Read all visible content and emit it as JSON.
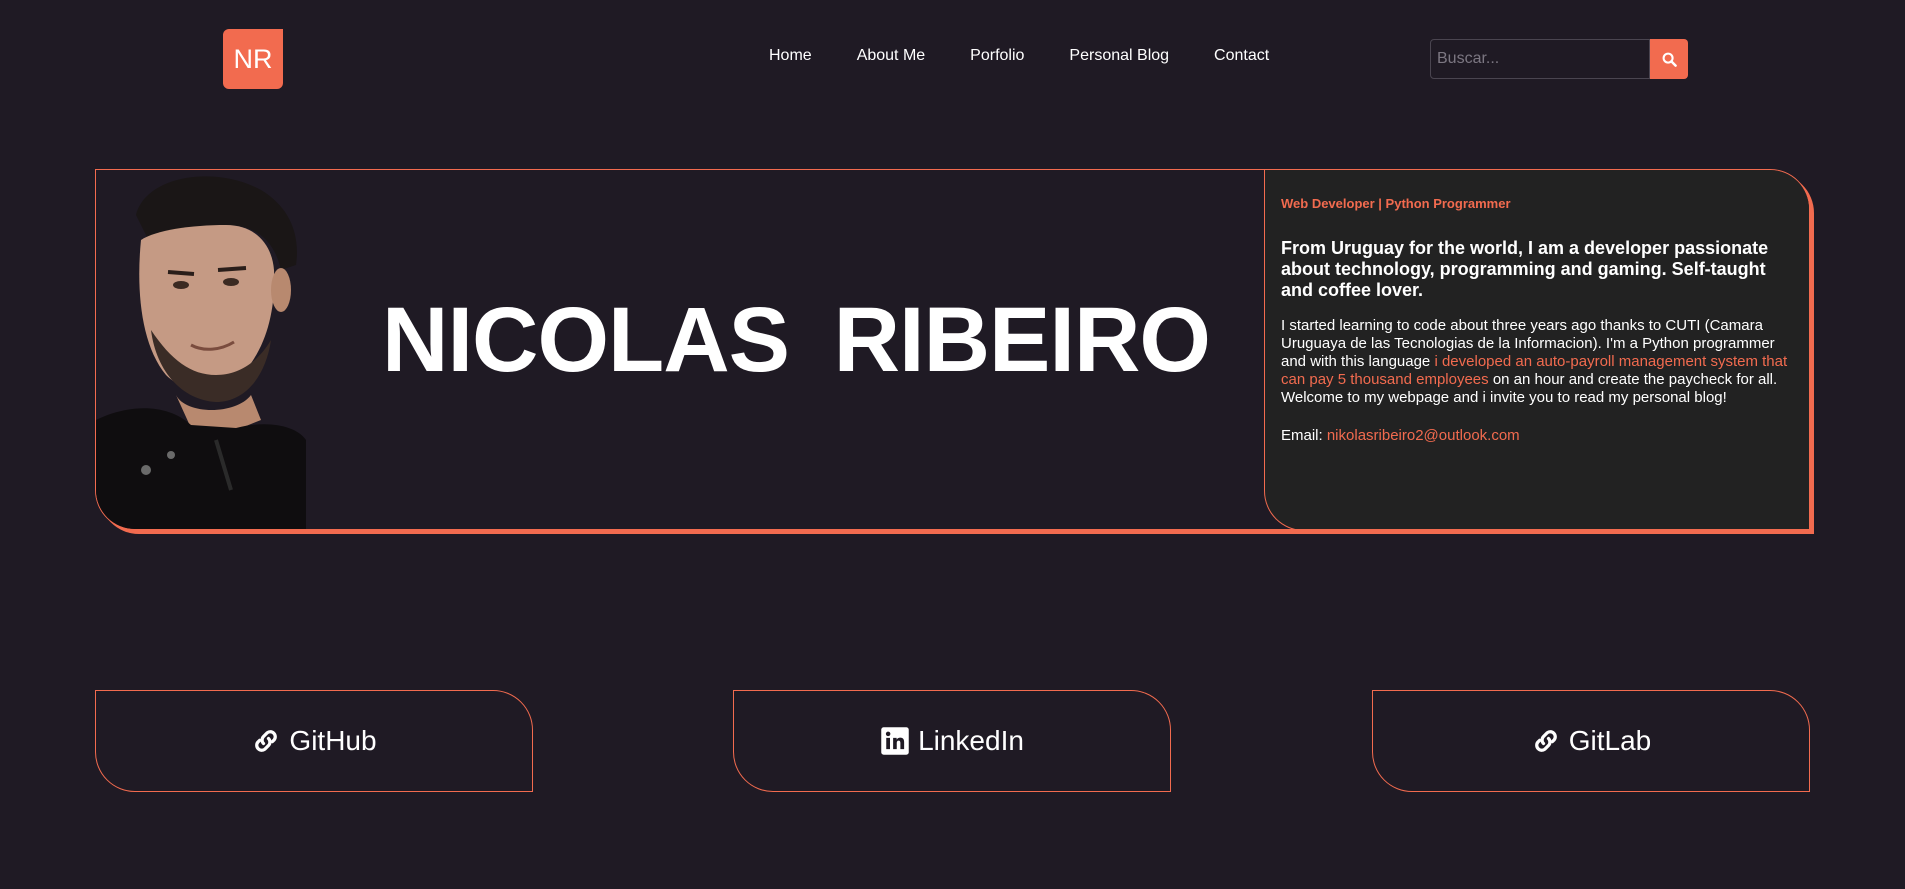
{
  "header": {
    "logo_text": "NR",
    "nav": [
      "Home",
      "About Me",
      "Porfolio",
      "Personal Blog",
      "Contact"
    ],
    "search": {
      "placeholder": "Buscar...",
      "value": ""
    }
  },
  "hero": {
    "name": "NICOLAS RIBEIRO",
    "role": "Web Developer | Python Programmer",
    "lead": "From Uruguay for the world, I am a developer passionate about technology, programming and gaming. Self-taught and coffee lover.",
    "body_before": "I started learning to code about three years ago thanks to CUTI (Camara Uruguaya de las Tecnologias de la Informacion). I'm a Python programmer and with this language ",
    "body_accent": "i developed an auto-payroll management system that can pay 5 thousand employees",
    "body_after": " on an hour and create the paycheck for all. Welcome to my webpage and i invite you to read my personal blog!",
    "email_label": "Email: ",
    "email": "nikolasribeiro2@outlook.com"
  },
  "links": {
    "github": "GitHub",
    "linkedin": "LinkedIn",
    "gitlab": "GitLab"
  },
  "colors": {
    "background": "#1f1a24",
    "accent": "#f26b4f",
    "panel": "#222222",
    "text": "#ffffff"
  },
  "icons": {
    "search": "search-icon",
    "github": "link-icon",
    "linkedin": "linkedin-icon",
    "gitlab": "link-icon"
  }
}
